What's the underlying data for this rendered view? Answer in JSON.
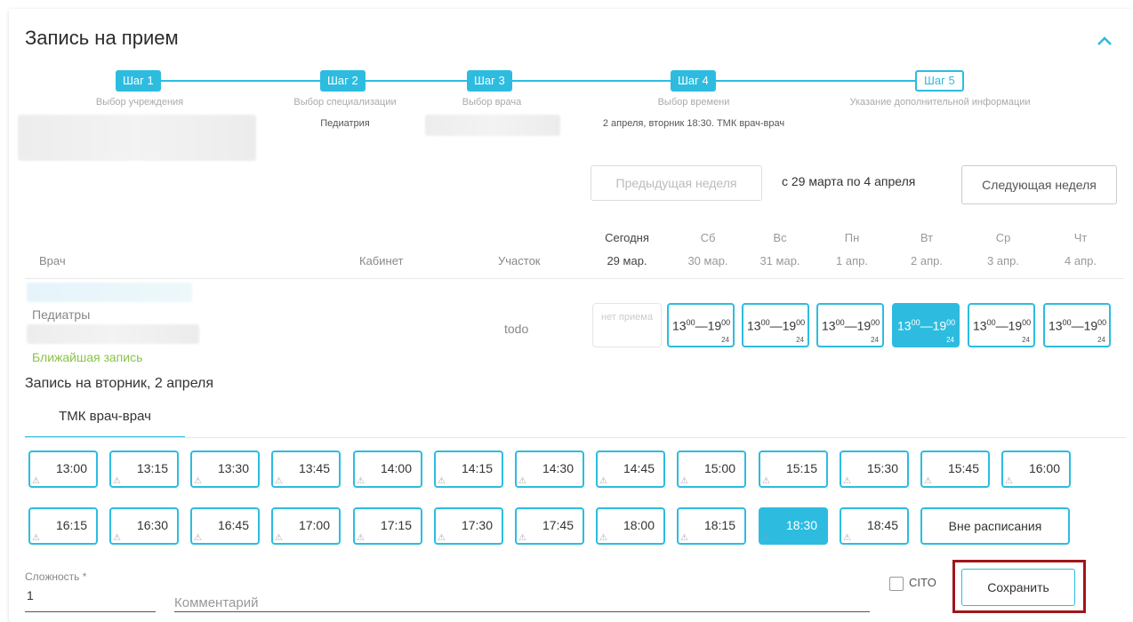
{
  "title": "Запись на прием",
  "steps": [
    {
      "label": "Шаг 1",
      "caption": "Выбор учреждения",
      "value": ""
    },
    {
      "label": "Шаг 2",
      "caption": "Выбор специализации",
      "value": "Педиатрия"
    },
    {
      "label": "Шаг 3",
      "caption": "Выбор врача",
      "value": ""
    },
    {
      "label": "Шаг 4",
      "caption": "Выбор времени",
      "value": "2 апреля, вторник 18:30. ТМК врач-врач"
    },
    {
      "label": "Шаг 5",
      "caption": "Указание дополнительной информации",
      "value": ""
    }
  ],
  "week_nav": {
    "prev": "Предыдущая неделя",
    "range": "с 29 марта по 4 апреля",
    "next": "Следующая неделя"
  },
  "table": {
    "col_doctor": "Врач",
    "col_cabinet": "Кабинет",
    "col_area": "Участок",
    "days": [
      {
        "name": "Сегодня",
        "date": "29 мар."
      },
      {
        "name": "Сб",
        "date": "30 мар."
      },
      {
        "name": "Вс",
        "date": "31 мар."
      },
      {
        "name": "Пн",
        "date": "1 апр."
      },
      {
        "name": "Вт",
        "date": "2 апр."
      },
      {
        "name": "Ср",
        "date": "3 апр."
      },
      {
        "name": "Чт",
        "date": "4 апр."
      }
    ]
  },
  "doctor_row": {
    "group": "Педиатры",
    "area": "todo",
    "nearest": "Ближайшая запись",
    "no_reception": "нет приема",
    "slot_start_h": "13",
    "slot_start_m": "00",
    "slot_end_h": "19",
    "slot_end_m": "00",
    "slot_count": "24",
    "selected_day_index": 4
  },
  "booking_heading": "Запись на вторник, 2 апреля",
  "tab_label": "ТМК врач-врач",
  "times_row1": [
    "13:00",
    "13:15",
    "13:30",
    "13:45",
    "14:00",
    "14:15",
    "14:30",
    "14:45",
    "15:00",
    "15:15",
    "15:30",
    "15:45",
    "16:00"
  ],
  "times_row2": [
    "16:15",
    "16:30",
    "16:45",
    "17:00",
    "17:15",
    "17:30",
    "17:45",
    "18:00",
    "18:15",
    "18:30",
    "18:45"
  ],
  "selected_time": "18:30",
  "outside_schedule": "Вне расписания",
  "complexity": {
    "label": "Сложность *",
    "value": "1"
  },
  "comment_placeholder": "Комментарий",
  "cito_label": "CITO",
  "save_label": "Сохранить",
  "accent": "#2dbce0"
}
